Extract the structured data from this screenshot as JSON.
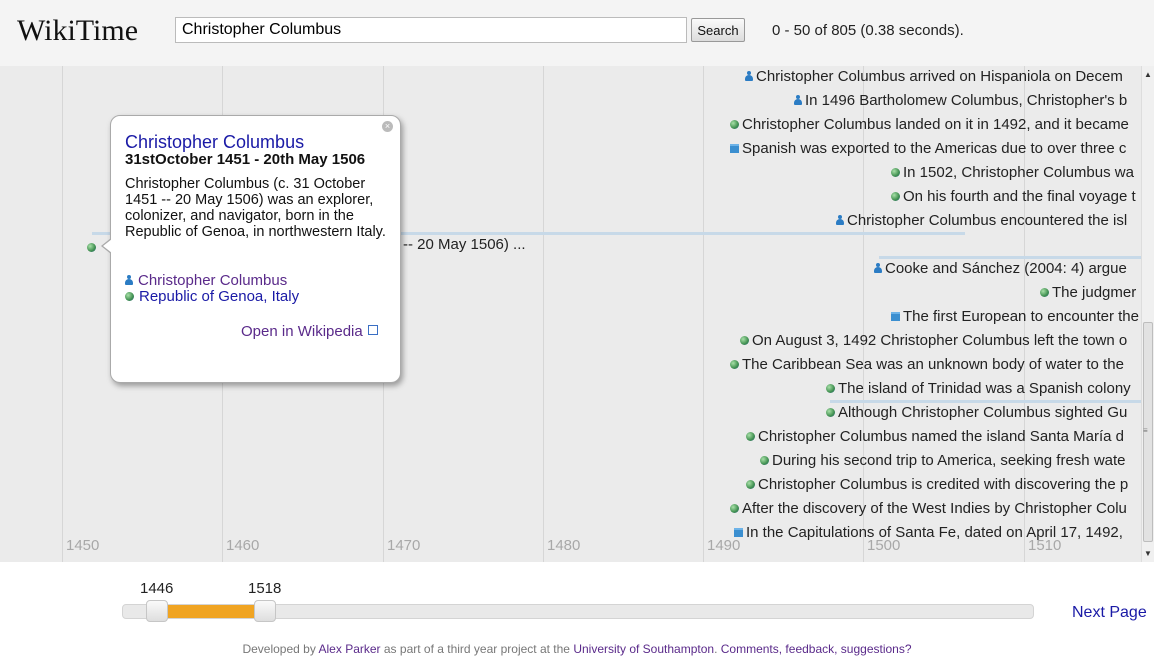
{
  "app": {
    "logo": "WikiTime"
  },
  "search": {
    "value": "Christopher Columbus",
    "button_label": "Search",
    "results": "0 - 50 of 805 (0.38 seconds)."
  },
  "timeline": {
    "year_labels": [
      "1450",
      "1460",
      "1470",
      "1480",
      "1490",
      "1500",
      "1510"
    ],
    "partial_event_text": "-- 20 May 1506) ...",
    "events": [
      {
        "icon": "person",
        "text": "Christopher Columbus arrived on Hispaniola on Decem"
      },
      {
        "icon": "person",
        "text": "In 1496 Bartholomew Columbus, Christopher's b"
      },
      {
        "icon": "globe",
        "text": "Christopher Columbus landed on it in 1492, and it became"
      },
      {
        "icon": "building",
        "text": "Spanish was exported to the Americas due to over three c"
      },
      {
        "icon": "globe",
        "text": "In 1502, Christopher Columbus wa"
      },
      {
        "icon": "globe",
        "text": "On his fourth and the final voyage t"
      },
      {
        "icon": "person",
        "text": "Christopher Columbus encountered the isl"
      },
      {
        "icon": "person",
        "text": "Cooke and Sánchez (2004: 4) argue"
      },
      {
        "icon": "globe",
        "text": "The judgmer"
      },
      {
        "icon": "building",
        "text": "The first European to encounter the"
      },
      {
        "icon": "globe",
        "text": "On August 3, 1492 Christopher Columbus left the town o"
      },
      {
        "icon": "globe",
        "text": "The Caribbean Sea was an unknown body of water to the"
      },
      {
        "icon": "globe",
        "text": "The island of Trinidad was a Spanish colony"
      },
      {
        "icon": "globe",
        "text": "Although Christopher Columbus sighted Gu"
      },
      {
        "icon": "globe",
        "text": "Christopher Columbus named the island Santa María d"
      },
      {
        "icon": "globe",
        "text": "During his second trip to America, seeking fresh wate"
      },
      {
        "icon": "globe",
        "text": "Christopher Columbus is credited with discovering the p"
      },
      {
        "icon": "globe",
        "text": "After the discovery of the West Indies by Christopher Colu"
      },
      {
        "icon": "building",
        "text": "In the Capitulations of Santa Fe, dated on April 17, 1492,"
      }
    ]
  },
  "popup": {
    "title": "Christopher Columbus",
    "dates": "31stOctober 1451 - 20th May 1506",
    "description": "Christopher Columbus (c. 31 October 1451 -- 20 May 1506) was an explorer, colonizer, and navigator, born in the Republic of Genoa, in northwestern Italy.",
    "links": [
      {
        "icon": "person",
        "label": "Christopher Columbus"
      },
      {
        "icon": "globe",
        "label": "Republic of Genoa, Italy"
      }
    ],
    "open_link": "Open in Wikipedia"
  },
  "range": {
    "start": "1446",
    "end": "1518",
    "next_page": "Next Page"
  },
  "footer": {
    "prefix": "Developed by ",
    "author": "Alex Parker",
    "middle": " as part of a third year project at the ",
    "university": "University of Southampton",
    "dot": ". ",
    "feedback": "Comments, feedback, suggestions?"
  },
  "colors": {
    "range_fill": "#f0a422",
    "link": "#1a1aa6",
    "visited_link": "#5a2a8a",
    "timeline_bg": "#ebebeb"
  }
}
